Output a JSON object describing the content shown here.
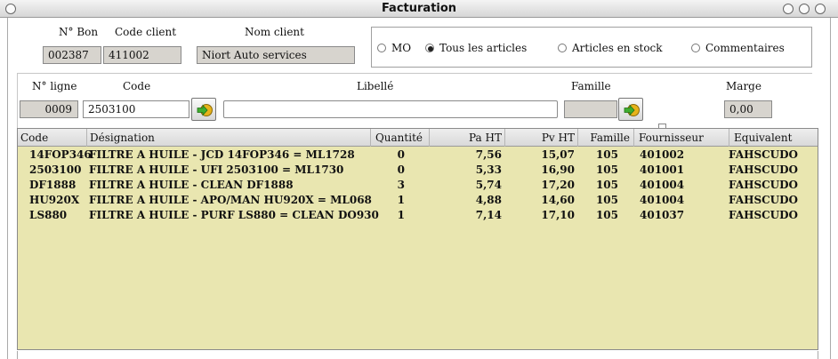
{
  "window": {
    "title": "Facturation"
  },
  "header": {
    "num_bon_label": "N° Bon",
    "num_bon_value": "002387",
    "code_client_label": "Code client",
    "code_client_value": "411002",
    "nom_client_label": "Nom client",
    "nom_client_value": "Niort Auto services"
  },
  "filter": {
    "options": [
      {
        "label": "MO",
        "selected": false
      },
      {
        "label": "Tous les articles",
        "selected": true
      },
      {
        "label": "Articles en stock",
        "selected": false
      },
      {
        "label": "Commentaires",
        "selected": false
      }
    ]
  },
  "line": {
    "num_label": "N° ligne",
    "num_value": "0009",
    "code_label": "Code",
    "code_value": "2503100",
    "libelle_label": "Libellé",
    "libelle_value": "",
    "famille_label": "Famille",
    "famille_value": "",
    "marge_label": "Marge",
    "marge_value": "0,00"
  },
  "table": {
    "columns": [
      "Code",
      "Désignation",
      "Quantité",
      "Pa HT",
      "Pv HT",
      "Famille",
      "Fournisseur",
      "Equivalent"
    ],
    "rows": [
      [
        "14FOP346",
        "FILTRE A HUILE - JCD 14FOP346 = ML1728",
        "0",
        "7,56",
        "15,07",
        "105",
        "401002",
        "FAHSCUDO"
      ],
      [
        "2503100",
        "FILTRE A HUILE - UFI 2503100 = ML1730",
        "0",
        "5,33",
        "16,90",
        "105",
        "401001",
        "FAHSCUDO"
      ],
      [
        "DF1888",
        "FILTRE A HUILE - CLEAN DF1888",
        "3",
        "5,74",
        "17,20",
        "105",
        "401004",
        "FAHSCUDO"
      ],
      [
        "HU920X",
        "FILTRE A HUILE - APO/MAN HU920X = ML068",
        "1",
        "4,88",
        "14,60",
        "105",
        "401004",
        "FAHSCUDO"
      ],
      [
        "LS880",
        "FILTRE A HUILE - PURF LS880 = CLEAN DO930",
        "1",
        "7,14",
        "17,10",
        "105",
        "401037",
        "FAHSCUDO"
      ]
    ]
  },
  "colors": {
    "grid_bg": "#e9e6b0",
    "readonly_field": "#d7d4ce"
  }
}
